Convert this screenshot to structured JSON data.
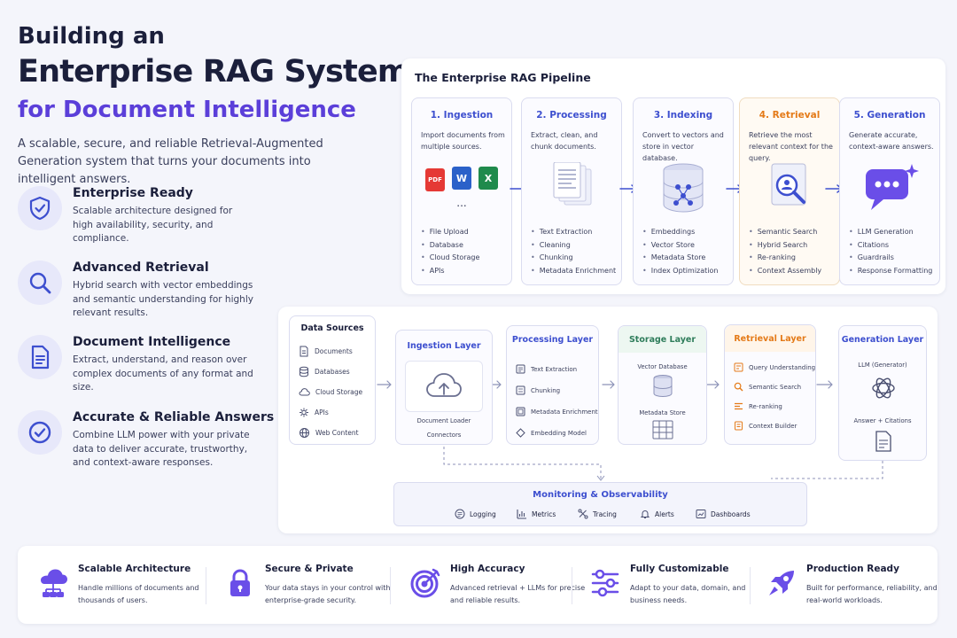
{
  "hero": {
    "line1": "Building an",
    "line2": "Enterprise RAG System",
    "line3": "for Document Intelligence",
    "intro": "A scalable, secure, and reliable Retrieval-Augmented Generation system that turns your documents into intelligent answers."
  },
  "features": [
    {
      "icon": "shield-check-icon",
      "title": "Enterprise Ready",
      "desc": "Scalable architecture designed for high availability, security, and compliance."
    },
    {
      "icon": "magnifier-icon",
      "title": "Advanced Retrieval",
      "desc": "Hybrid search with vector embeddings and semantic understanding for highly relevant results."
    },
    {
      "icon": "document-icon",
      "title": "Document Intelligence",
      "desc": "Extract, understand, and reason over complex documents of any format and size."
    },
    {
      "icon": "check-circle-icon",
      "title": "Accurate & Reliable Answers",
      "desc": "Combine LLM power with your private data to deliver accurate, trustworthy, and context-aware responses."
    }
  ],
  "pipeline": {
    "title": "The Enterprise RAG Pipeline",
    "stages": [
      {
        "title": "1. Ingestion",
        "desc": "Import documents from multiple sources.",
        "items": [
          "File Upload",
          "Database",
          "Cloud Storage",
          "APIs"
        ],
        "file_badges": [
          "PDF",
          "W",
          "X"
        ],
        "more": "..."
      },
      {
        "title": "2. Processing",
        "desc": "Extract, clean, and chunk documents.",
        "items": [
          "Text Extraction",
          "Cleaning",
          "Chunking",
          "Metadata Enrichment"
        ]
      },
      {
        "title": "3. Indexing",
        "desc": "Convert to vectors and store in vector database.",
        "items": [
          "Embeddings",
          "Vector Store",
          "Metadata Store",
          "Index Optimization"
        ]
      },
      {
        "title": "4. Retrieval",
        "desc": "Retrieve the most relevant context for the query.",
        "items": [
          "Semantic Search",
          "Hybrid Search",
          "Re-ranking",
          "Context Assembly"
        ]
      },
      {
        "title": "5. Generation",
        "desc": "Generate accurate, context-aware answers.",
        "items": [
          "LLM Generation",
          "Citations",
          "Guardrails",
          "Response Formatting"
        ]
      }
    ]
  },
  "architecture": {
    "sources": {
      "title": "Data Sources",
      "items": [
        "Documents",
        "Databases",
        "Cloud Storage",
        "APIs",
        "Web Content"
      ]
    },
    "ingestion": {
      "title": "Ingestion Layer",
      "caption1": "Document Loader",
      "caption2": "Connectors"
    },
    "processing": {
      "title": "Processing Layer",
      "items": [
        "Text Extraction",
        "Chunking",
        "Metadata Enrichment",
        "Embedding Model"
      ]
    },
    "storage": {
      "title": "Storage Layer",
      "vector": "Vector Database",
      "meta": "Metadata Store"
    },
    "retrieval": {
      "title": "Retrieval Layer",
      "items": [
        "Query Understanding",
        "Semantic Search",
        "Re-ranking",
        "Context Builder"
      ]
    },
    "generation": {
      "title": "Generation Layer",
      "top": "LLM (Generator)",
      "bottom": "Answer + Citations"
    },
    "monitoring": {
      "title": "Monitoring & Observability",
      "items": [
        "Logging",
        "Metrics",
        "Tracing",
        "Alerts",
        "Dashboards"
      ]
    }
  },
  "bottom": [
    {
      "icon": "cloud-network-icon",
      "title": "Scalable Architecture",
      "desc": "Handle millions of documents and thousands of users."
    },
    {
      "icon": "lock-icon",
      "title": "Secure & Private",
      "desc": "Your data stays in your control with enterprise-grade security."
    },
    {
      "icon": "target-icon",
      "title": "High Accuracy",
      "desc": "Advanced retrieval + LLMs for precise and reliable results."
    },
    {
      "icon": "sliders-icon",
      "title": "Fully Customizable",
      "desc": "Adapt to your data, domain, and business needs."
    },
    {
      "icon": "rocket-icon",
      "title": "Production Ready",
      "desc": "Built for performance, reliability, and real-world workloads."
    }
  ],
  "colors": {
    "accent": "#5b3fd9",
    "blue": "#3d4fcf",
    "orange": "#e47a18",
    "green": "#2f7d5b",
    "ink": "#1b1f3b"
  }
}
